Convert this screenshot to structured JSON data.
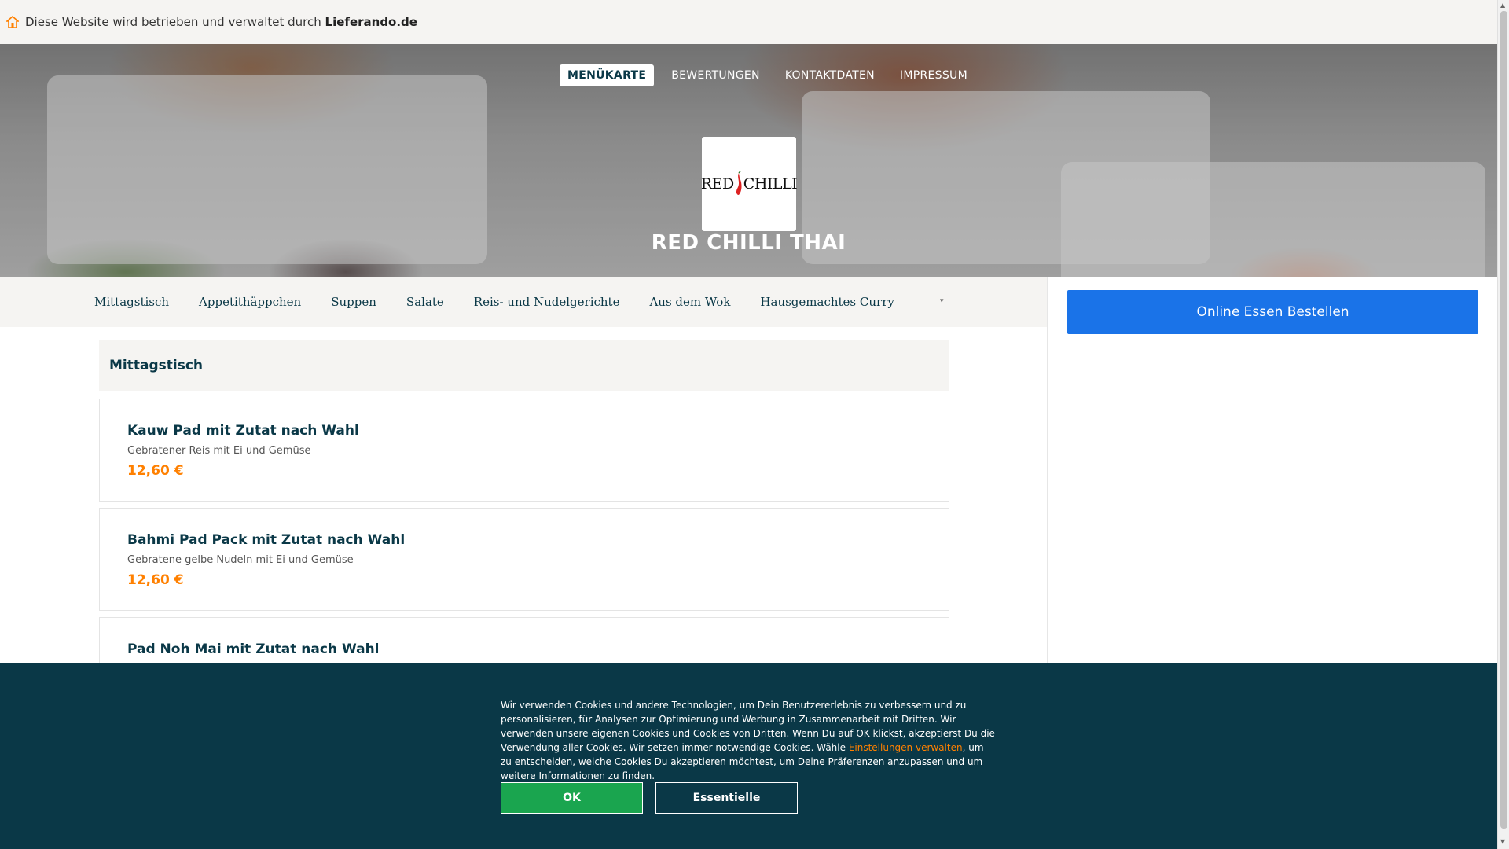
{
  "topbar": {
    "text": "Diese Website wird betrieben und verwaltet durch ",
    "brand": "Lieferando.de",
    "icon": "home-icon"
  },
  "nav": {
    "items": [
      "MENÜKARTE",
      "BEWERTUNGEN",
      "KONTAKTDATEN",
      "IMPRESSUM"
    ]
  },
  "restaurant": {
    "logo_left": "RED",
    "logo_right": "CHILLI",
    "name": "RED CHILLI THAI"
  },
  "categories": {
    "items": [
      "Mittagstisch",
      "Appetithäppchen",
      "Suppen",
      "Salate",
      "Reis- und Nudelgerichte",
      "Aus dem Wok",
      "Hausgemachtes Curry"
    ],
    "more_icon": "chevron-down-icon"
  },
  "sidebar": {
    "order_label": "Online Essen Bestellen"
  },
  "menu": {
    "section_title": "Mittagstisch",
    "items": [
      {
        "name": "Kauw Pad mit Zutat nach Wahl",
        "desc": "Gebratener Reis mit Ei und Gemüse",
        "price": "12,60 €"
      },
      {
        "name": "Bahmi Pad Pack mit Zutat nach Wahl",
        "desc": "Gebratene gelbe Nudeln mit Ei und Gemüse",
        "price": "12,60 €"
      },
      {
        "name": "Pad Noh Mai mit Zutat nach Wahl",
        "desc": "",
        "price": ""
      }
    ]
  },
  "cookie": {
    "text_before": "Wir verwenden Cookies und andere Technologien, um Dein Benutzererlebnis zu verbessern und zu personalisieren, für Analysen zur Optimierung und Werbung in Zusammenarbeit mit Dritten. Wir verwenden unsere eigenen Cookies und Cookies von Dritten. Wenn Du auf OK klickst, akzeptierst Du die Verwendung aller Cookies. Wir setzen immer notwendige Cookies. Wähle ",
    "link": "Einstellungen verwalten",
    "text_after": ", um zu entscheiden, welche Cookies Du akzeptieren möchtest, um Deine Präferenzen anzupassen und um weitere Informationen zu finden.",
    "ok_label": "OK",
    "essential_label": "Essentielle"
  }
}
